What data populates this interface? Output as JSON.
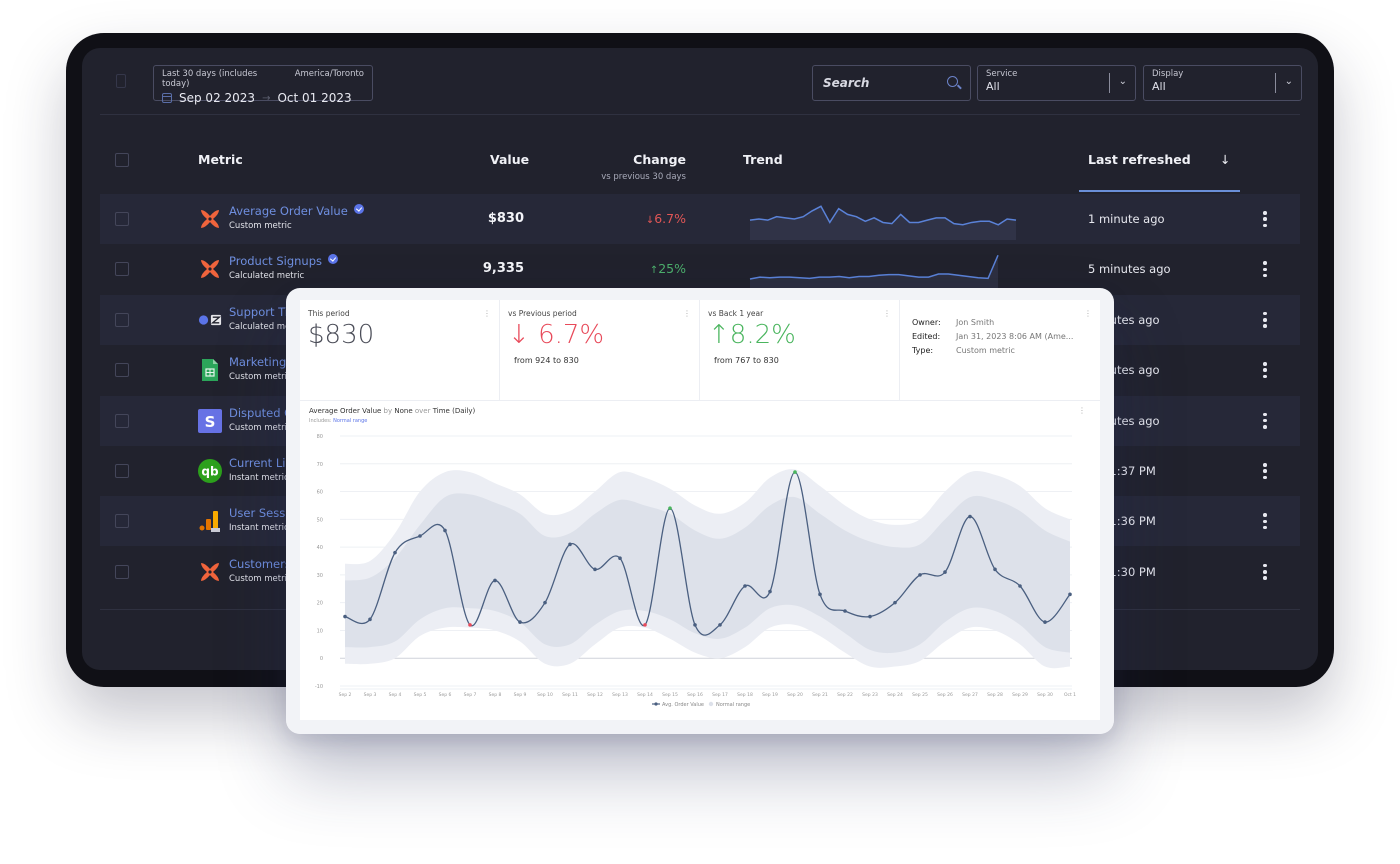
{
  "toolbar": {
    "date_range": {
      "label": "Last 30 days (includes today)",
      "timezone": "America/Toronto",
      "start": "Sep 02 2023",
      "end": "Oct 01 2023",
      "arrow": "→"
    },
    "search": {
      "placeholder": "Search"
    },
    "service": {
      "label": "Service",
      "value": "All"
    },
    "display": {
      "label": "Display",
      "value": "All"
    }
  },
  "table": {
    "headers": {
      "metric": "Metric",
      "value": "Value",
      "change": "Change",
      "change_sub": "vs previous 30 days",
      "trend": "Trend",
      "last_refreshed": "Last refreshed",
      "sort_icon": "↓"
    },
    "rows": [
      {
        "name": "Average Order Value",
        "type": "Custom metric",
        "verified": true,
        "source": "klipfolio",
        "value": "$830",
        "change": "6.7%",
        "direction": "down",
        "arrow": "↓",
        "refreshed": "1 minute ago",
        "trend": [
          52,
          53,
          52,
          55,
          54,
          53,
          55,
          60,
          64,
          50,
          62,
          57,
          55,
          51,
          54,
          50,
          49,
          57,
          50,
          50,
          52,
          54,
          54,
          49,
          48,
          50,
          51,
          51,
          48,
          53,
          52
        ]
      },
      {
        "name": "Product Signups",
        "type": "Calculated metric",
        "verified": true,
        "source": "klipfolio",
        "value": "9,335",
        "change": "25%",
        "direction": "up",
        "arrow": "↑",
        "refreshed": "5 minutes ago",
        "trend": [
          20,
          23,
          22,
          23,
          23,
          22,
          21,
          23,
          23,
          24,
          22,
          24,
          24,
          26,
          27,
          27,
          25,
          23,
          23,
          28,
          28,
          26,
          24,
          22,
          21,
          58
        ]
      },
      {
        "name": "Support Tickets",
        "type": "Calculated metric",
        "source": "zendesk",
        "refreshed": "minutes ago"
      },
      {
        "name": "Marketing",
        "type": "Custom metric",
        "source": "google-sheets",
        "refreshed": "minutes ago"
      },
      {
        "name": "Disputed Charges",
        "type": "Custom metric",
        "source": "stripe",
        "refreshed": "minutes ago"
      },
      {
        "name": "Current Liabilities",
        "type": "Instant metric",
        "source": "quickbooks",
        "refreshed": "y, 01:37 PM"
      },
      {
        "name": "User Sessions",
        "type": "Instant metric",
        "source": "google-analytics",
        "refreshed": "y, 01:36 PM"
      },
      {
        "name": "Customers",
        "type": "Custom metric",
        "source": "klipfolio",
        "refreshed": "y, 01:30 PM"
      }
    ]
  },
  "detail": {
    "this_period": {
      "label": "This period",
      "value": "$830"
    },
    "vs_previous": {
      "label": "vs Previous period",
      "arrow": "↓",
      "value": "6.7%",
      "sub": "from 924 to 830",
      "direction": "down"
    },
    "vs_year": {
      "label": "vs Back 1 year",
      "arrow": "↑",
      "value": "8.2%",
      "sub": "from 767 to 830",
      "direction": "up"
    },
    "meta": {
      "owner_label": "Owner:",
      "owner": "Jon Smith",
      "edited_label": "Edited:",
      "edited": "Jan 31, 2023 8:06 AM (Ame...",
      "type_label": "Type:",
      "type": "Custom metric"
    },
    "menu_icon": "⋮"
  },
  "chart_data": {
    "type": "line",
    "title_parts": {
      "metric": "Average Order Value",
      "by": "by",
      "group": "None",
      "over": "over",
      "time": "Time (Daily)"
    },
    "includes_label": "Includes:",
    "includes_value": "Normal range",
    "x": [
      "Sep 2",
      "Sep 3",
      "Sep 4",
      "Sep 5",
      "Sep 6",
      "Sep 7",
      "Sep 8",
      "Sep 9",
      "Sep 10",
      "Sep 11",
      "Sep 12",
      "Sep 13",
      "Sep 14",
      "Sep 15",
      "Sep 16",
      "Sep 17",
      "Sep 18",
      "Sep 19",
      "Sep 20",
      "Sep 21",
      "Sep 22",
      "Sep 23",
      "Sep 24",
      "Sep 25",
      "Sep 26",
      "Sep 27",
      "Sep 28",
      "Sep 29",
      "Sep 30",
      "Oct 1"
    ],
    "series": [
      {
        "name": "Avg. Order Value",
        "color": "#4a5f80",
        "values": [
          15,
          14,
          38,
          44,
          46,
          12,
          28,
          13,
          20,
          41,
          32,
          36,
          12,
          54,
          12,
          12,
          26,
          24,
          67,
          23,
          17,
          15,
          20,
          30,
          31,
          51,
          32,
          26,
          13,
          23
        ],
        "highlight_low": [
          5,
          12
        ],
        "highlight_high": [
          13,
          18
        ]
      }
    ],
    "normal_range": {
      "name": "Normal range",
      "inner_upper": [
        28,
        29,
        36,
        48,
        58,
        59,
        56,
        52,
        44,
        45,
        52,
        57,
        55,
        52,
        46,
        43,
        47,
        55,
        58,
        52,
        46,
        42,
        40,
        41,
        50,
        58,
        57,
        53,
        46,
        42
      ],
      "inner_lower": [
        4,
        4,
        6,
        14,
        18,
        18,
        17,
        13,
        5,
        5,
        12,
        17,
        17,
        14,
        9,
        7,
        11,
        18,
        19,
        15,
        9,
        3,
        2,
        5,
        13,
        18,
        17,
        12,
        4,
        2
      ],
      "outer_upper": [
        34,
        35,
        45,
        60,
        67,
        67,
        63,
        59,
        52,
        53,
        60,
        67,
        65,
        61,
        55,
        52,
        56,
        65,
        68,
        62,
        55,
        50,
        48,
        50,
        60,
        67,
        66,
        62,
        54,
        50
      ],
      "outer_lower": [
        -2,
        -2,
        0,
        8,
        11,
        11,
        10,
        6,
        -2,
        -2,
        5,
        11,
        11,
        7,
        2,
        0,
        4,
        11,
        12,
        8,
        2,
        -3,
        -3,
        -1,
        6,
        11,
        10,
        5,
        -3,
        -3
      ]
    },
    "ylim": [
      -10,
      80
    ],
    "yticks": [
      80,
      70,
      60,
      50,
      40,
      30,
      20,
      10,
      0,
      -10
    ],
    "grid": true,
    "legend_position": "bottom-center",
    "legend": [
      "Avg. Order Value",
      "Normal range"
    ]
  }
}
